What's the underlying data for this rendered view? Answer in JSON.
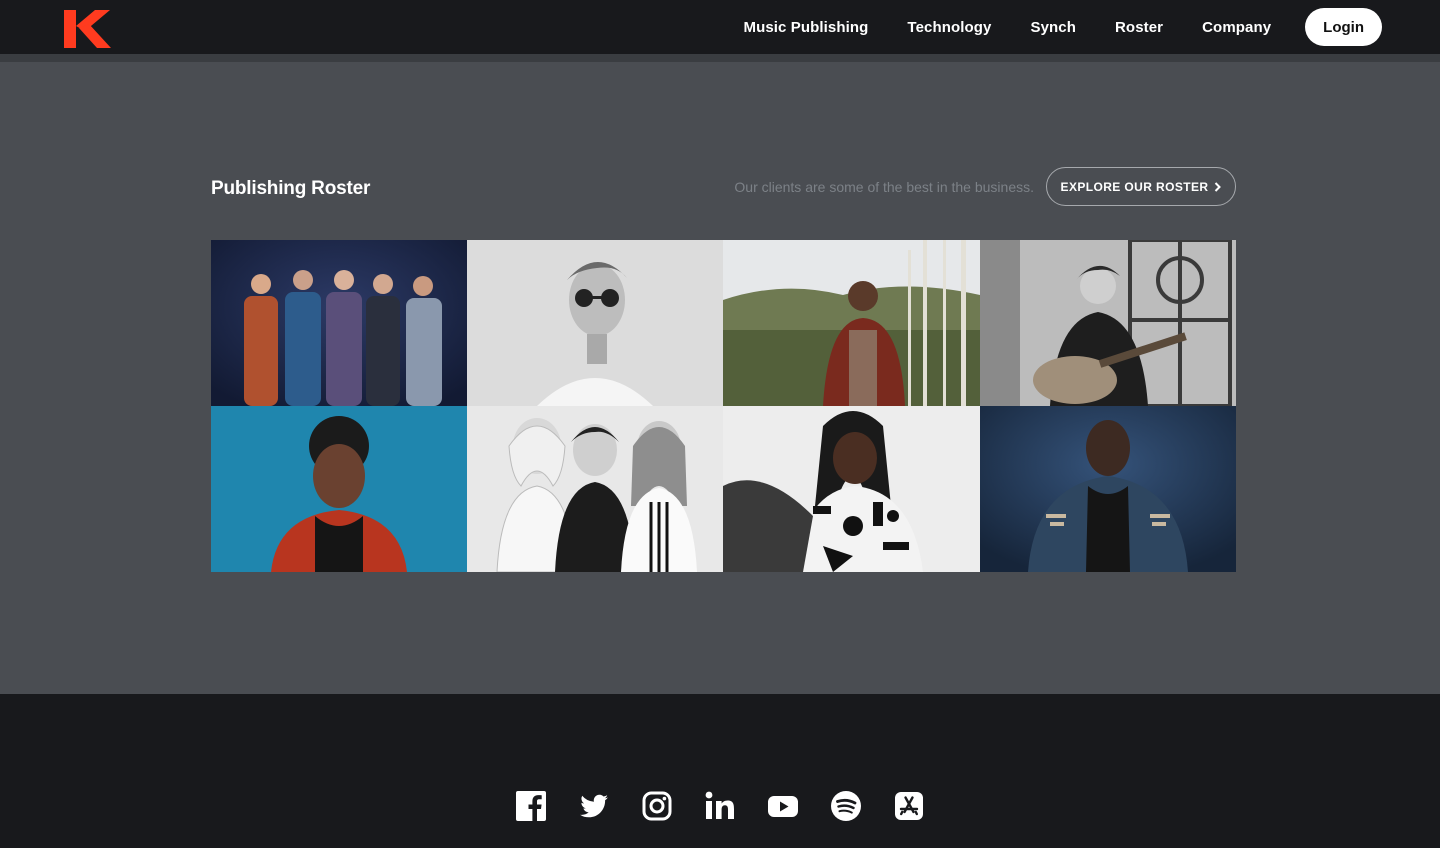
{
  "header": {
    "logo_icon": "k-logo-icon",
    "brand_color": "#ff3b1f",
    "nav": [
      "Music Publishing",
      "Technology",
      "Synch",
      "Roster",
      "Company"
    ],
    "login_label": "Login"
  },
  "roster": {
    "title": "Publishing Roster",
    "tagline": "Our clients are some of the best in the business.",
    "explore_label": "EXPLORE OUR ROSTER",
    "explore_icon": "chevron-right-icon",
    "tiles": [
      {
        "name": "roster-photo-band-group",
        "tone": "color"
      },
      {
        "name": "roster-photo-sunglasses-portrait",
        "tone": "grayscale"
      },
      {
        "name": "roster-photo-forest-portrait",
        "tone": "color"
      },
      {
        "name": "roster-photo-guitarist-window",
        "tone": "grayscale"
      },
      {
        "name": "roster-photo-blue-backdrop-portrait",
        "tone": "color"
      },
      {
        "name": "roster-photo-trio-portrait",
        "tone": "grayscale"
      },
      {
        "name": "roster-photo-patterned-dress-portrait",
        "tone": "color"
      },
      {
        "name": "roster-photo-denim-jacket-portrait",
        "tone": "color"
      }
    ]
  },
  "footer": {
    "social": [
      "facebook-icon",
      "twitter-icon",
      "instagram-icon",
      "linkedin-icon",
      "youtube-icon",
      "spotify-icon",
      "app-store-icon"
    ]
  }
}
